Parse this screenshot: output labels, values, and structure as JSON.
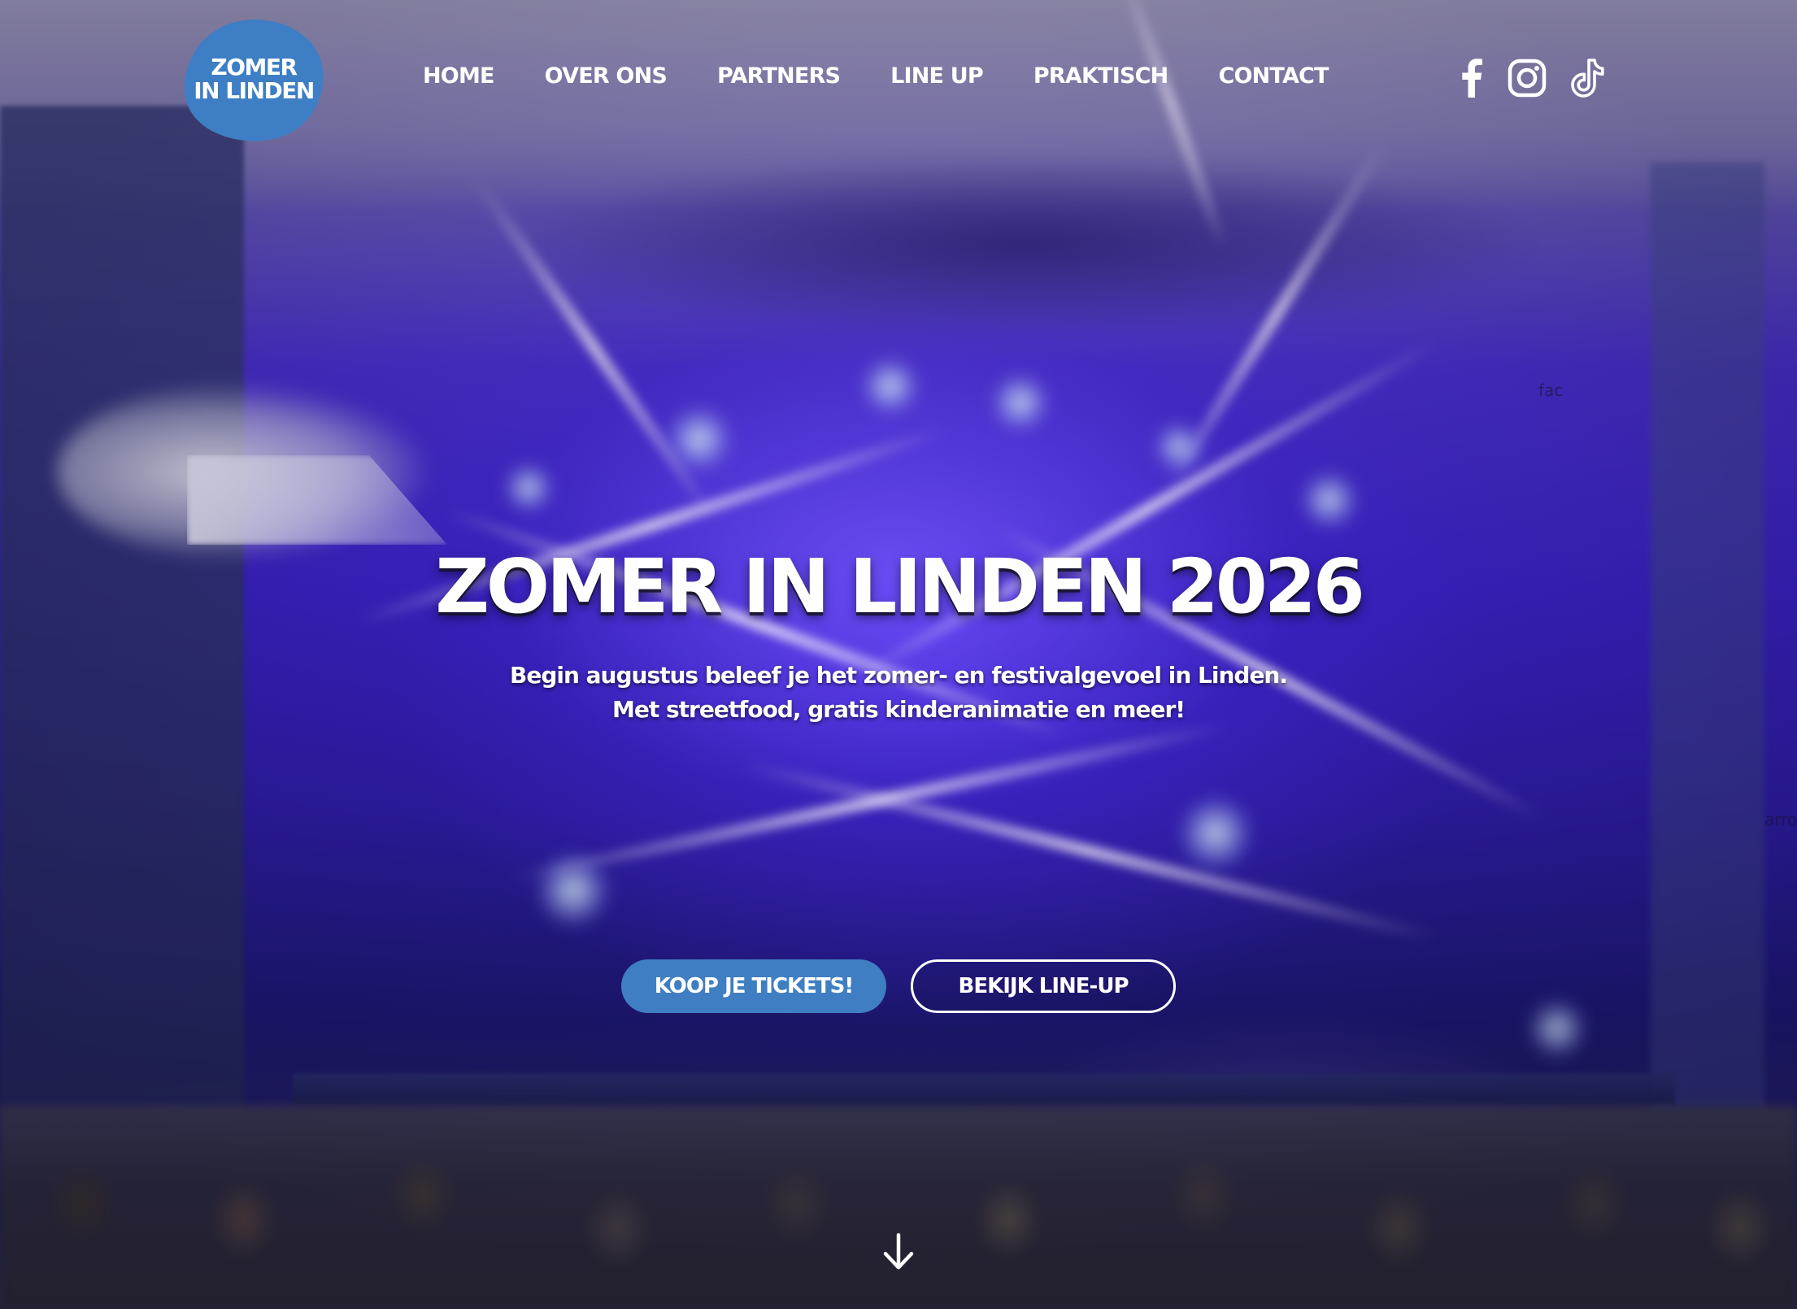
{
  "brand": {
    "logo_line1": "ZOMER",
    "logo_line2": "IN LINDEN",
    "accent_color": "#3d7ec4"
  },
  "nav": {
    "items": [
      {
        "label": "HOME"
      },
      {
        "label": "OVER ONS"
      },
      {
        "label": "PARTNERS"
      },
      {
        "label": "LINE UP"
      },
      {
        "label": "PRAKTISCH"
      },
      {
        "label": "CONTACT"
      }
    ]
  },
  "social": {
    "icons": [
      "facebook-icon",
      "instagram-icon",
      "tiktok-icon"
    ]
  },
  "edge_labels": {
    "right_top": "fac",
    "right_middle": "arro"
  },
  "hero": {
    "title": "ZOMER IN LINDEN 2026",
    "subtitle_line1": "Begin augustus beleef je het zomer- en festivalgevoel in Linden.",
    "subtitle_line2": "Met streetfood, gratis kinderanimatie en meer!",
    "primary_button": "KOOP JE TICKETS!",
    "secondary_button": "BEKIJK LINE-UP",
    "scroll_icon": "arrow-down-icon"
  }
}
